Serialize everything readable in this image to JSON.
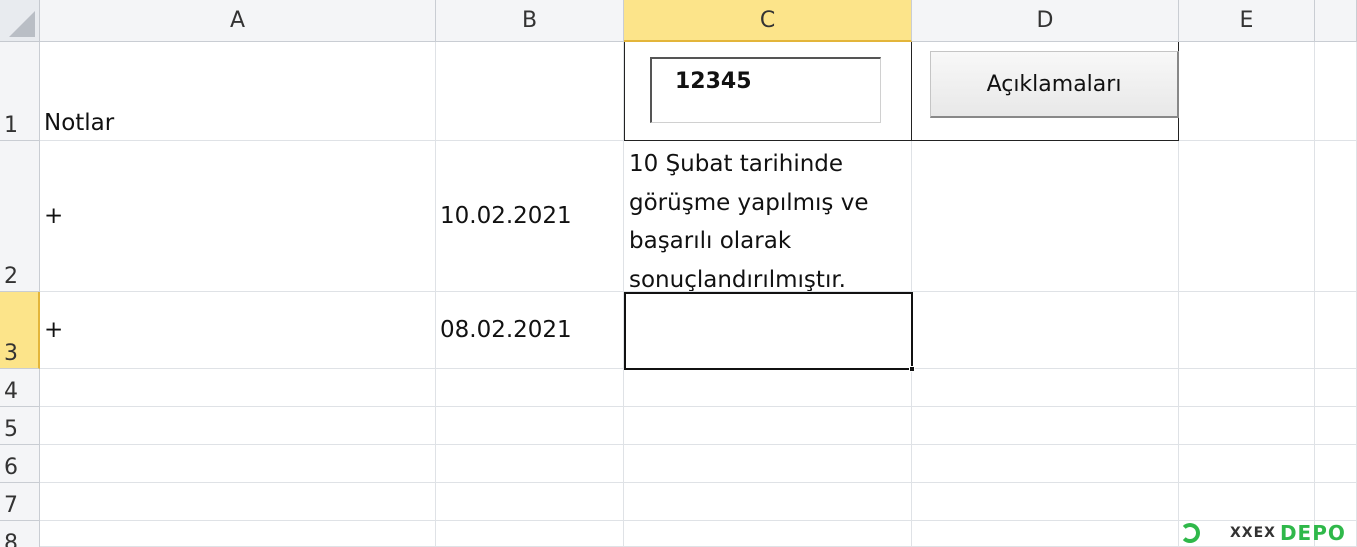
{
  "columns": [
    "A",
    "B",
    "C",
    "D",
    "E"
  ],
  "rows": [
    "1",
    "2",
    "3",
    "4",
    "5",
    "6",
    "7",
    "8"
  ],
  "selected": {
    "column": "C",
    "row": "3"
  },
  "cells": {
    "A1": "Notlar",
    "A2": "+",
    "B2": "10.02.2021",
    "C2": "10 Şubat tarihinde görüşme yapılmış ve başarılı olarak sonuçlandırılmıştır.",
    "A3": "+",
    "B3": "08.02.2021",
    "C3": ""
  },
  "controls": {
    "textbox_value": "12345",
    "button_label": "Açıklamaları"
  },
  "watermark": {
    "small": "XXEX",
    "brand": "DEPO"
  },
  "colors": {
    "header_selected": "#fce48a",
    "watermark_green": "#2fb84a"
  }
}
